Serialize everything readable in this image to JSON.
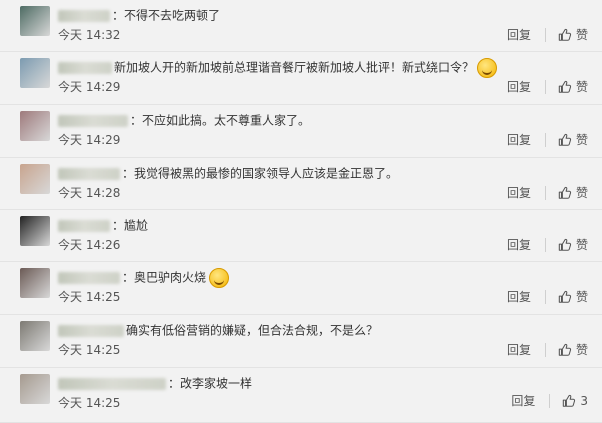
{
  "actions": {
    "reply_label": "回复",
    "like_label": "赞",
    "like_icon": "thumbs-up-icon"
  },
  "comments": [
    {
      "text": "：不得不去吃两顿了",
      "time": "今天 14:32",
      "likes": "赞",
      "emoji": false,
      "avatar_color": "#4d6b63",
      "name_w": 52
    },
    {
      "text": "新加坡人开的新加坡前总理谐音餐厅被新加坡人批评！新式绕口令？",
      "time": "今天 14:29",
      "likes": "赞",
      "emoji": true,
      "avatar_color": "#7c9bb0",
      "name_w": 54
    },
    {
      "text": "：不应如此搞。太不尊重人家了。",
      "time": "今天 14:29",
      "likes": "赞",
      "emoji": false,
      "avatar_color": "#9e7a7c",
      "name_w": 70
    },
    {
      "text": "：我觉得被黑的最惨的国家领导人应该是金正恩了。",
      "time": "今天 14:28",
      "likes": "赞",
      "emoji": false,
      "avatar_color": "#c8a48e",
      "name_w": 62
    },
    {
      "text": "：尴尬",
      "time": "今天 14:26",
      "likes": "赞",
      "emoji": false,
      "avatar_color": "#222222",
      "name_w": 52
    },
    {
      "text": "：奥巴驴肉火烧",
      "time": "今天 14:25",
      "likes": "赞",
      "emoji": true,
      "avatar_color": "#6b5a55",
      "name_w": 62
    },
    {
      "text": "确实有低俗营销的嫌疑，但合法合规，不是么？",
      "time": "今天 14:25",
      "likes": "赞",
      "emoji": false,
      "avatar_color": "#7d7a73",
      "name_w": 66
    },
    {
      "text": "：改李家坡一样",
      "time": "今天 14:25",
      "likes": "3",
      "emoji": false,
      "avatar_color": "#a59a8f",
      "name_w": 108
    }
  ]
}
